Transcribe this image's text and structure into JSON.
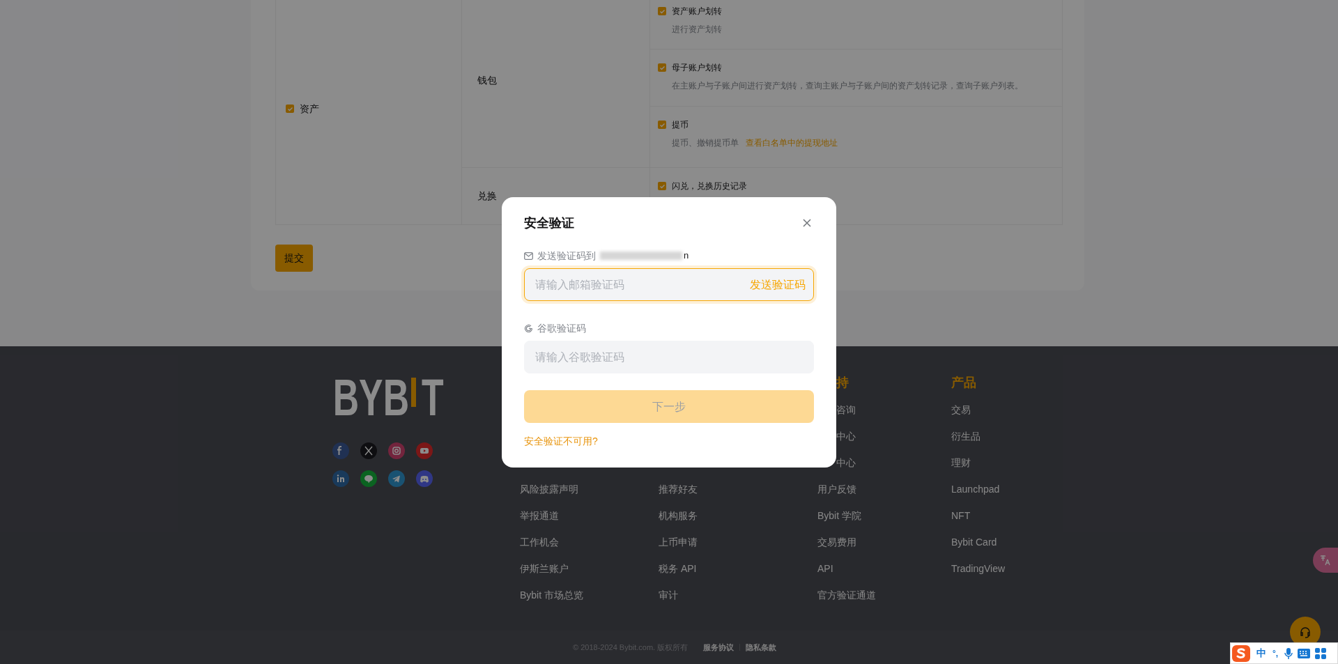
{
  "permissions": {
    "group": {
      "label": "资产",
      "checked": true
    },
    "sections": [
      {
        "name": "钱包",
        "items": [
          {
            "label": "资产账户划转",
            "checked": true,
            "description": "进行资产划转"
          },
          {
            "label": "母子账户划转",
            "checked": true,
            "description": "在主账户与子账户间进行资产划转，查询主账户与子账户间的资产划转记录，查询子账户列表。"
          },
          {
            "label": "提币",
            "checked": true,
            "description": "提币、撤销提币单",
            "link": "查看白名单中的提现地址"
          }
        ]
      },
      {
        "name": "兑换",
        "items": [
          {
            "label": "闪兑，兑换历史记录",
            "checked": true
          }
        ]
      }
    ]
  },
  "submit_button": "提交",
  "footer": {
    "logo": {
      "left": "BYB",
      "right": "T"
    },
    "columns": [
      {
        "items": [
          "风险披露声明",
          "举报通道",
          "工作机会",
          "伊斯兰账户",
          "Bybit 市场总览"
        ]
      },
      {
        "items": [
          "推荐好友",
          "机构服务",
          "上币申请",
          "税务 API",
          "审计"
        ]
      },
      {
        "heading": "持",
        "items": [
          "咨询",
          "中心",
          "中心",
          "用户反馈",
          "Bybit 学院",
          "交易费用",
          "API",
          "官方验证通道"
        ]
      },
      {
        "heading": "产品",
        "items": [
          "交易",
          "衍生品",
          "理财",
          "Launchpad",
          "NFT",
          "Bybit Card",
          "TradingView"
        ]
      }
    ]
  },
  "legal": {
    "copyright": "© 2018-2024 Bybit.com. 版权所有",
    "links": [
      "服务协议",
      "隐私条款"
    ]
  },
  "dialog": {
    "title": "安全验证",
    "email_label": "发送验证码到",
    "email_tail": "n",
    "email_field": {
      "placeholder": "请输入邮箱验证码",
      "focused": true,
      "action": "发送验证码"
    },
    "google_label": "谷歌验证码",
    "google_field": {
      "placeholder": "请输入谷歌验证码",
      "focused": false
    },
    "next_button": {
      "label": "下一步",
      "disabled": true
    },
    "help_link": "安全验证不可用?"
  },
  "ime": {
    "mode": "中",
    "punctuation": "°,"
  }
}
